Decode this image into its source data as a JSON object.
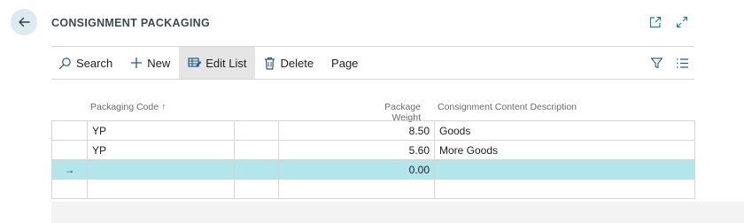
{
  "page": {
    "title": "CONSIGNMENT PACKAGING"
  },
  "icons": {
    "back": "arrow-left-icon",
    "open_new_window": "open-in-new-window-icon",
    "expand": "expand-icon",
    "search": "search-icon",
    "new": "plus-icon",
    "edit_list": "edit-list-icon",
    "delete": "trash-icon",
    "filter": "filter-icon",
    "list_view": "list-view-icon",
    "sort_asc": "arrow-up-icon",
    "row_arrow": "arrow-right-icon"
  },
  "actionbar": {
    "search_label": "Search",
    "new_label": "New",
    "edit_list_label": "Edit List",
    "delete_label": "Delete",
    "page_label": "Page"
  },
  "grid": {
    "columns": {
      "packaging_code": "Packaging Code",
      "package_weight": "Package Weight",
      "content_description": "Consignment Content Description",
      "sort_indicator": "↑"
    },
    "rows": [
      {
        "marker": "",
        "packaging_code": "YP",
        "weight": "8.50",
        "description": "Goods"
      },
      {
        "marker": "",
        "packaging_code": "YP",
        "weight": "5.60",
        "description": "More Goods"
      },
      {
        "marker": "→",
        "packaging_code": "",
        "weight": "0.00",
        "description": ""
      },
      {
        "marker": "",
        "packaging_code": "",
        "weight": "",
        "description": ""
      }
    ]
  },
  "colors": {
    "active_row": "#b2e6ea",
    "back_button_bg": "#dcebf0",
    "accent": "#1f7fa6"
  }
}
